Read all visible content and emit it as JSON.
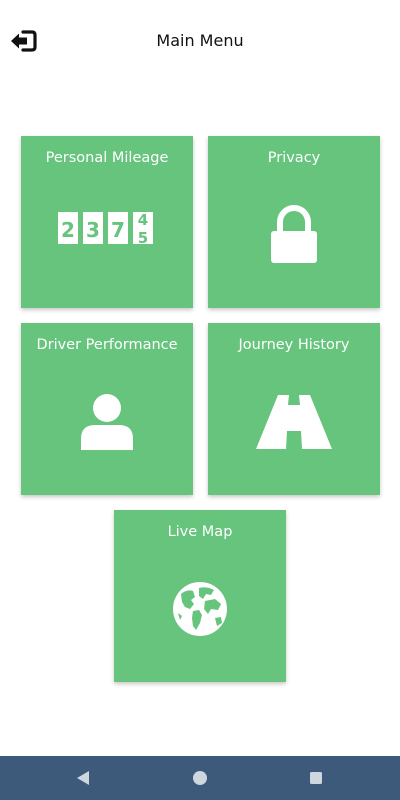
{
  "header": {
    "title": "Main Menu",
    "back_icon": "exit-arrow-icon"
  },
  "tiles": [
    {
      "label": "Personal Mileage",
      "icon": "odometer-icon"
    },
    {
      "label": "Privacy",
      "icon": "padlock-icon"
    },
    {
      "label": "Driver Performance",
      "icon": "person-icon"
    },
    {
      "label": "Journey History",
      "icon": "road-icon"
    },
    {
      "label": "Live Map",
      "icon": "globe-icon"
    }
  ],
  "odometer": {
    "digits": [
      "2",
      "3",
      "7"
    ],
    "rolling_digits": [
      "4",
      "5"
    ]
  },
  "navigation_bar": {
    "icons": [
      "nav-back-icon",
      "nav-home-icon",
      "nav-recents-icon"
    ]
  },
  "colors": {
    "tile": "#66c47d",
    "nav_bar": "#3d5a7a",
    "icon": "#ffffff"
  }
}
